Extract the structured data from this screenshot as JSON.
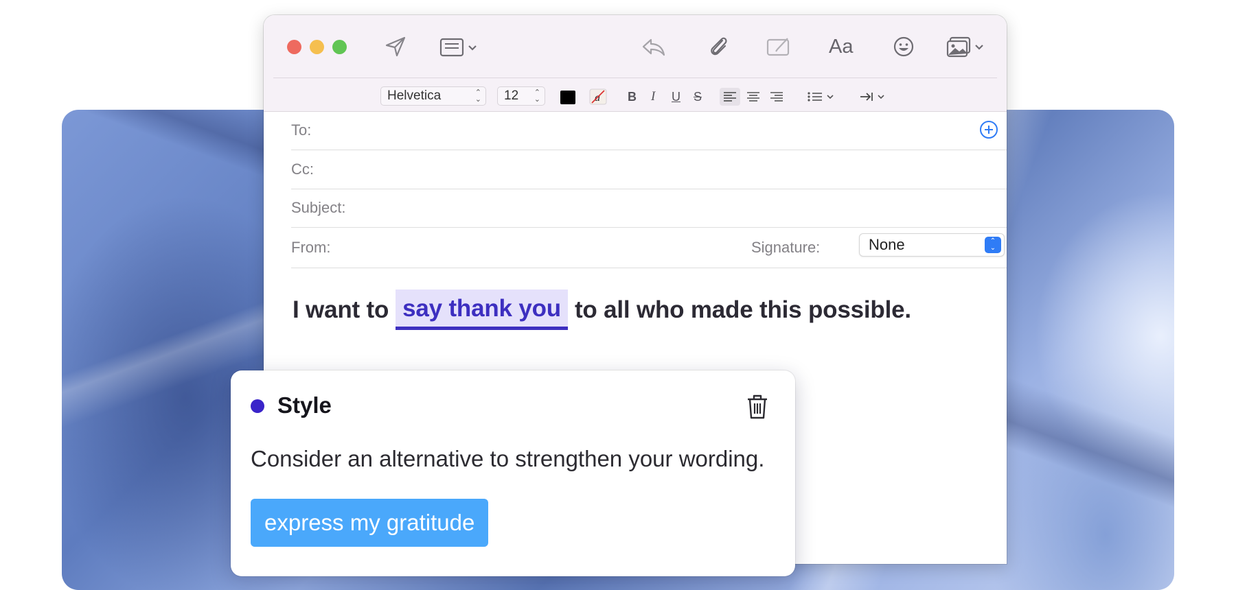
{
  "toolbar": {
    "icons": [
      "send-icon",
      "header-fields-icon",
      "reply-icon",
      "attachment-icon",
      "markup-icon",
      "fonts-icon",
      "emoji-icon",
      "photo-browser-icon"
    ],
    "fonts_label": "Aa"
  },
  "format_bar": {
    "font_family": "Helvetica",
    "font_size": "12",
    "text_color": "#000000",
    "bold": "B",
    "italic": "I",
    "underline": "U",
    "strikethrough": "S"
  },
  "fields": {
    "to_label": "To:",
    "cc_label": "Cc:",
    "subject_label": "Subject:",
    "from_label": "From:",
    "signature_label": "Signature:",
    "signature_value": "None"
  },
  "message": {
    "before": "I want to",
    "highlight": "say thank you",
    "after": "to all who made this possible."
  },
  "suggestion": {
    "category": "Style",
    "message": "Consider an alternative to strengthen your wording.",
    "replacement": "express my gratitude"
  },
  "colors": {
    "accent": "#3d2fc0",
    "highlight_bg": "#e5e1fb",
    "suggestion_button": "#4aa8fb",
    "signature_stepper": "#2f7cf6"
  }
}
